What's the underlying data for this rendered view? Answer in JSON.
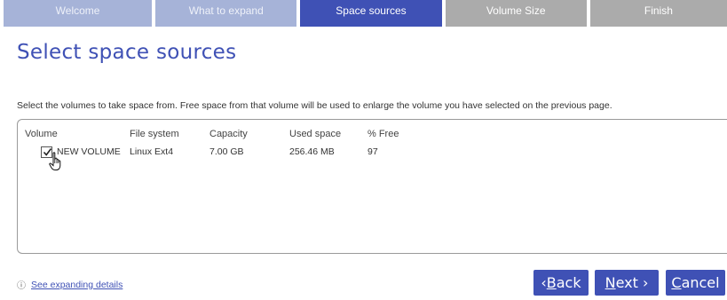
{
  "wizard": {
    "steps": [
      {
        "label": "Welcome",
        "state": "done"
      },
      {
        "label": "What to expand",
        "state": "done"
      },
      {
        "label": "Space sources",
        "state": "active"
      },
      {
        "label": "Volume Size",
        "state": "pending"
      },
      {
        "label": "Finish",
        "state": "pending"
      }
    ]
  },
  "page": {
    "title": "Select space sources",
    "instructions": "Select the volumes to take space from. Free space from that volume will be used to enlarge the volume you have selected on the previous page."
  },
  "table": {
    "headers": [
      "Volume",
      "File system",
      "Capacity",
      "Used space",
      "% Free"
    ],
    "rows": [
      {
        "checked": true,
        "volume": "NEW VOLUME",
        "file_system": "Linux Ext4",
        "capacity": "7.00 GB",
        "used_space": "256.46 MB",
        "free_pct": "97"
      }
    ]
  },
  "footer": {
    "info_icon": "info-icon",
    "details_link": "See expanding details",
    "back_prefix": "‹ ",
    "back_hotkey": "B",
    "back_rest": "ack",
    "next_hotkey": "N",
    "next_rest": "ext ›",
    "cancel_hotkey": "C",
    "cancel_rest": "ancel"
  },
  "colors": {
    "accent": "#3f51b5",
    "step_done": "#a6b3d8",
    "step_pending": "#ababab"
  }
}
